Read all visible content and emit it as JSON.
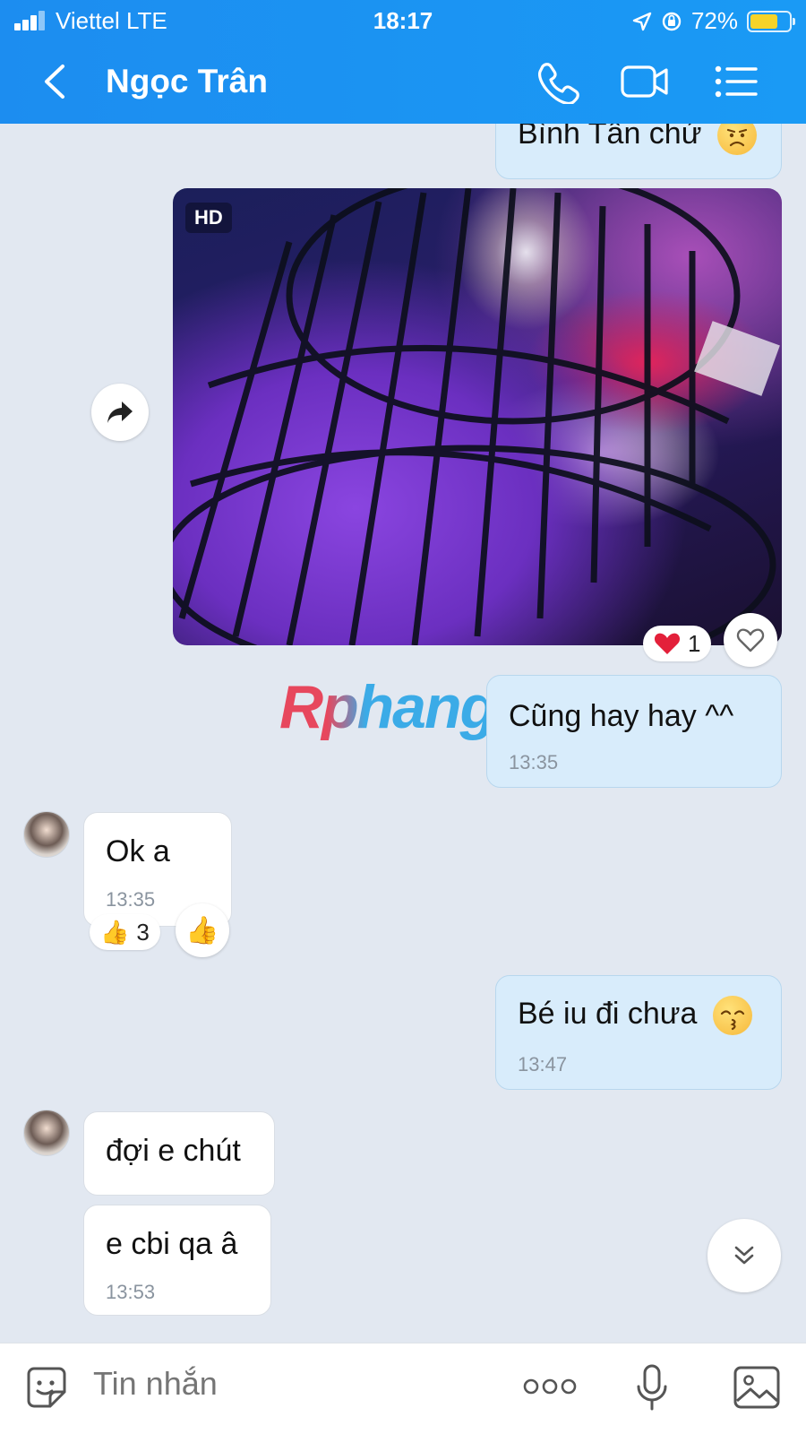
{
  "status_bar": {
    "carrier": "Viettel  LTE",
    "time": "18:17",
    "battery": "72%",
    "battery_level": 0.72
  },
  "header": {
    "contact_name": "Ngọc Trân"
  },
  "messages": {
    "m1": {
      "text": "Bình Tân chứ",
      "emoji": "worried-face"
    },
    "photo": {
      "badge": "HD",
      "reaction_count": "1",
      "reaction_emoji": "heart"
    },
    "m2": {
      "text": "Cũng hay hay ^^",
      "time": "13:35"
    },
    "m3": {
      "text": "Ok a",
      "time": "13:35",
      "reaction_count": "3",
      "reaction_emoji": "thumbs-up"
    },
    "m4": {
      "text": "Bé iu đi chưa",
      "time": "13:47",
      "emoji": "kissing-face"
    },
    "m5": {
      "text": "đợi e chút"
    },
    "m6": {
      "text": "e cbi qa â",
      "time": "13:53"
    }
  },
  "watermark": "Rphang",
  "composer": {
    "placeholder": "Tin nhắn"
  },
  "colors": {
    "header": "#1c8df0",
    "chat_bg": "#e2e8f1",
    "my_bubble": "#d8ecfb",
    "their_bubble": "#ffffff"
  }
}
